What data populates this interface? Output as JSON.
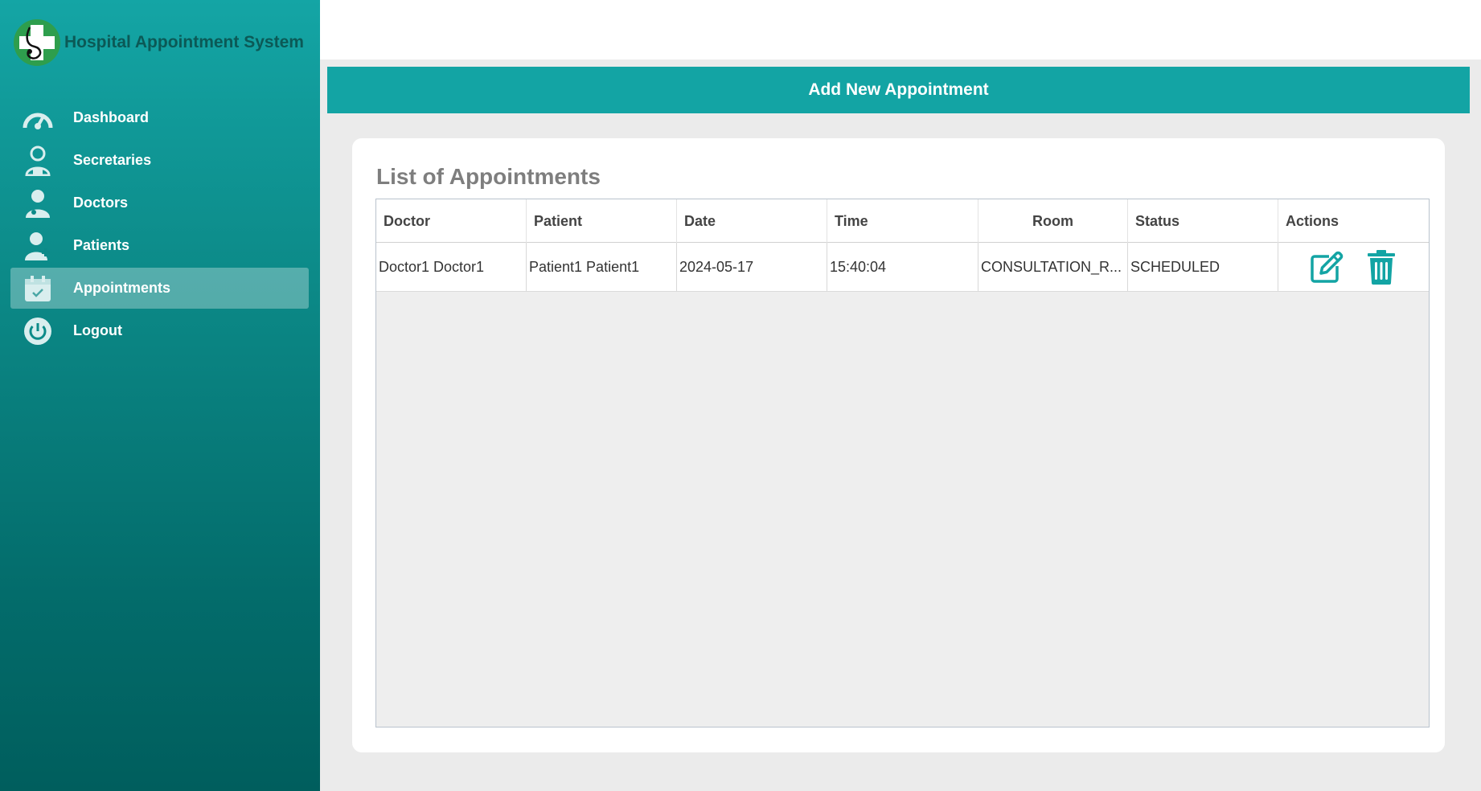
{
  "app": {
    "title": "Hospital Appointment System"
  },
  "sidebar": {
    "items": [
      {
        "label": "Dashboard",
        "icon": "gauge-icon",
        "active": false
      },
      {
        "label": "Secretaries",
        "icon": "secretary-icon",
        "active": false
      },
      {
        "label": "Doctors",
        "icon": "doctor-icon",
        "active": false
      },
      {
        "label": "Patients",
        "icon": "patient-icon",
        "active": false
      },
      {
        "label": "Appointments",
        "icon": "calendar-check-icon",
        "active": true
      },
      {
        "label": "Logout",
        "icon": "power-icon",
        "active": false
      }
    ]
  },
  "main": {
    "add_button_label": "Add New Appointment",
    "card_title": "List of Appointments",
    "table": {
      "columns": [
        "Doctor",
        "Patient",
        "Date",
        "Time",
        "Room",
        "Status",
        "Actions"
      ],
      "rows": [
        {
          "doctor": "Doctor1 Doctor1",
          "patient": "Patient1 Patient1",
          "date": "2024-05-17",
          "time": "15:40:04",
          "room": "CONSULTATION_R...",
          "status": "SCHEDULED"
        }
      ]
    }
  },
  "colors": {
    "accent": "#13a4a4",
    "sidebar_top": "#14a5a5",
    "sidebar_bottom": "#005e5d",
    "logo_green": "#2e9e4d"
  }
}
